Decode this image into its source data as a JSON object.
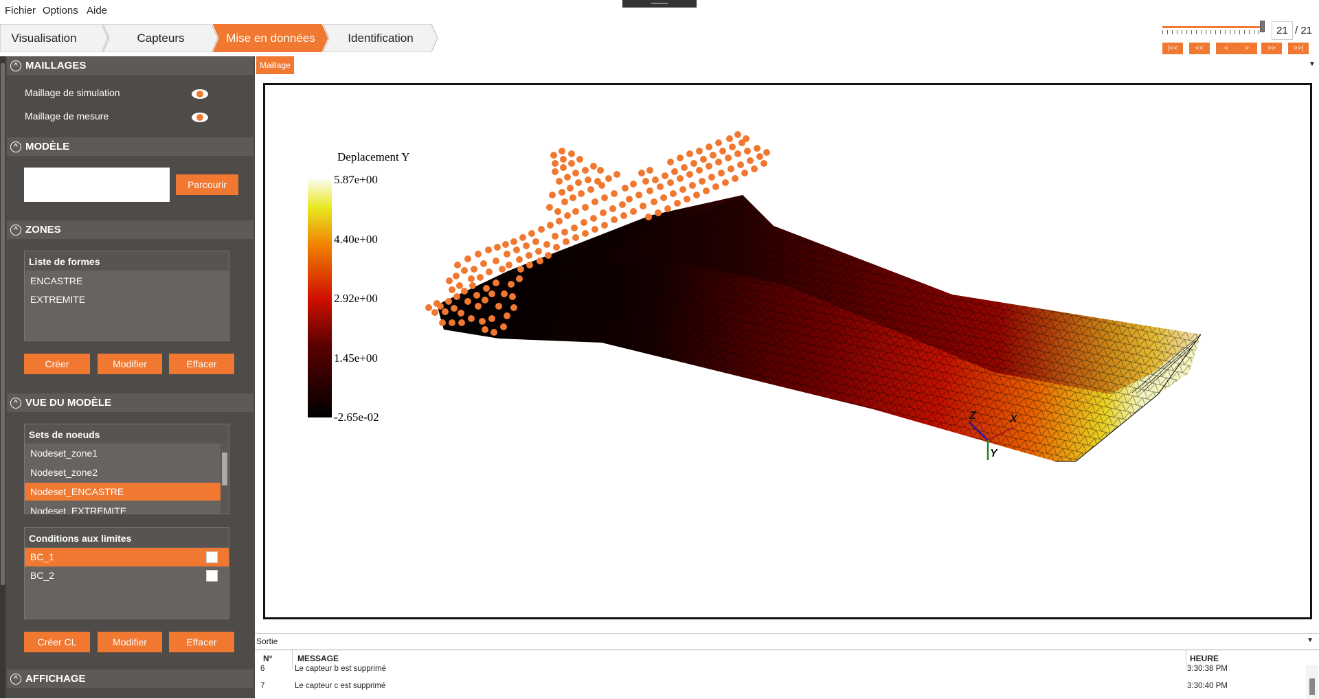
{
  "menu": {
    "file": "Fichier",
    "options": "Options",
    "help": "Aide"
  },
  "steps": [
    {
      "label": "Visualisation",
      "active": false
    },
    {
      "label": "Capteurs",
      "active": false
    },
    {
      "label": "Mise en données",
      "active": true
    },
    {
      "label": "Identification",
      "active": false
    }
  ],
  "player": {
    "current": "21",
    "total": "/ 21",
    "progress": 1.0,
    "buttons": [
      "|<<",
      "<<",
      "<",
      ">",
      ">>",
      ">>|"
    ]
  },
  "sidebar": {
    "maillages": {
      "title": "MAILLAGES",
      "items": [
        "Maillage de simulation",
        "Maillage de mesure"
      ]
    },
    "modele": {
      "title": "MODÈLE",
      "input_value": "",
      "browse": "Parcourir"
    },
    "zones": {
      "title": "ZONES",
      "list_title": "Liste de formes",
      "items": [
        "ENCASTRE",
        "EXTREMITE"
      ],
      "create": "Créer",
      "modify": "Modifier",
      "delete": "Effacer"
    },
    "vue": {
      "title": "VUE DU MODÈLE",
      "nodesets_title": "Sets de noeuds",
      "nodesets": [
        "Nodeset_zone1",
        "Nodeset_zone2",
        "Nodeset_ENCASTRE",
        "Nodeset_EXTREMITE"
      ],
      "nodeset_selected": 2,
      "bc_title": "Conditions aux limites",
      "bcs": [
        "BC_1",
        "BC_2"
      ],
      "create_bc": "Créer CL",
      "modify": "Modifier",
      "delete": "Effacer"
    },
    "affichage": {
      "title": "AFFICHAGE"
    }
  },
  "viewer": {
    "tab": "Maillage",
    "legend": {
      "title": "Deplacement Y",
      "ticks": [
        "5.87e+00",
        "4.40e+00",
        "2.92e+00",
        "1.45e+00",
        "-2.65e-02"
      ]
    },
    "axes": {
      "x": "X",
      "y": "Y",
      "z": "Z"
    }
  },
  "output": {
    "title": "Sortie",
    "columns": {
      "num": "N°",
      "message": "MESSAGE",
      "time": "HEURE"
    },
    "rows": [
      {
        "num": "6",
        "message": "Le capteur b est supprimé",
        "time": "3:30:38 PM"
      },
      {
        "num": "7",
        "message": "Le capteur c est supprimé",
        "time": "3:30:40 PM"
      }
    ]
  },
  "colors": {
    "accent": "#f07830",
    "sidebar": "#4e4b49",
    "section": "#5d5a58"
  }
}
